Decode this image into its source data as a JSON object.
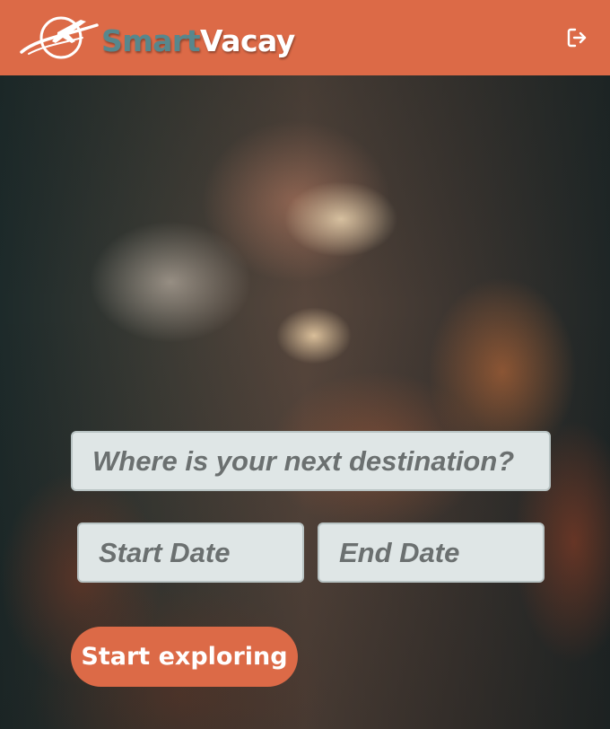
{
  "header": {
    "brand_part1": "Smart",
    "brand_part2": "Vacay",
    "logout_icon": "logout-icon"
  },
  "form": {
    "destination_placeholder": "Where is your next destination?",
    "start_date_placeholder": "Start Date",
    "end_date_placeholder": "End Date",
    "submit_label": "Start exploring"
  },
  "colors": {
    "brand_orange": "#dc6a47",
    "brand_teal": "#57878d",
    "input_bg": "#dfe6e6"
  }
}
